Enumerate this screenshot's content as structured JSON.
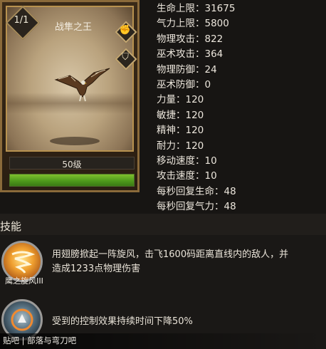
{
  "card": {
    "count": "1/1",
    "name": "战隼之王",
    "level": "50级",
    "hp_fill_percent": 100,
    "icons": [
      "fist-icon",
      "shield-icon"
    ]
  },
  "stats": [
    "生命上限：31675",
    "气力上限：5800",
    "物理攻击：822",
    "巫术攻击：364",
    "物理防御：24",
    "巫术防御：0",
    "力量：120",
    "敏捷：120",
    "精神：120",
    "耐力：120",
    "移动速度：10",
    "攻击速度：10",
    "每秒回复生命：48",
    "每秒回复气力：48"
  ],
  "skills": {
    "title": "技能",
    "items": [
      {
        "name": "鹰之旋风III",
        "icon": "whirlwind-icon",
        "desc_line1": "用翅膀掀起一阵旋风，击飞1600码距离直线内的敌人，并",
        "desc_line2": "造成1233点物理伤害"
      },
      {
        "name": "",
        "icon": "control-resist-icon",
        "desc_line1": "受到的控制效果持续时间下降50%"
      }
    ]
  },
  "footer": {
    "watermark": "贴吧 | 部落与弯刀吧"
  },
  "colors": {
    "hp_green": "#5fa824",
    "gold_frame": "#b8924f",
    "background": "#1a1816"
  }
}
